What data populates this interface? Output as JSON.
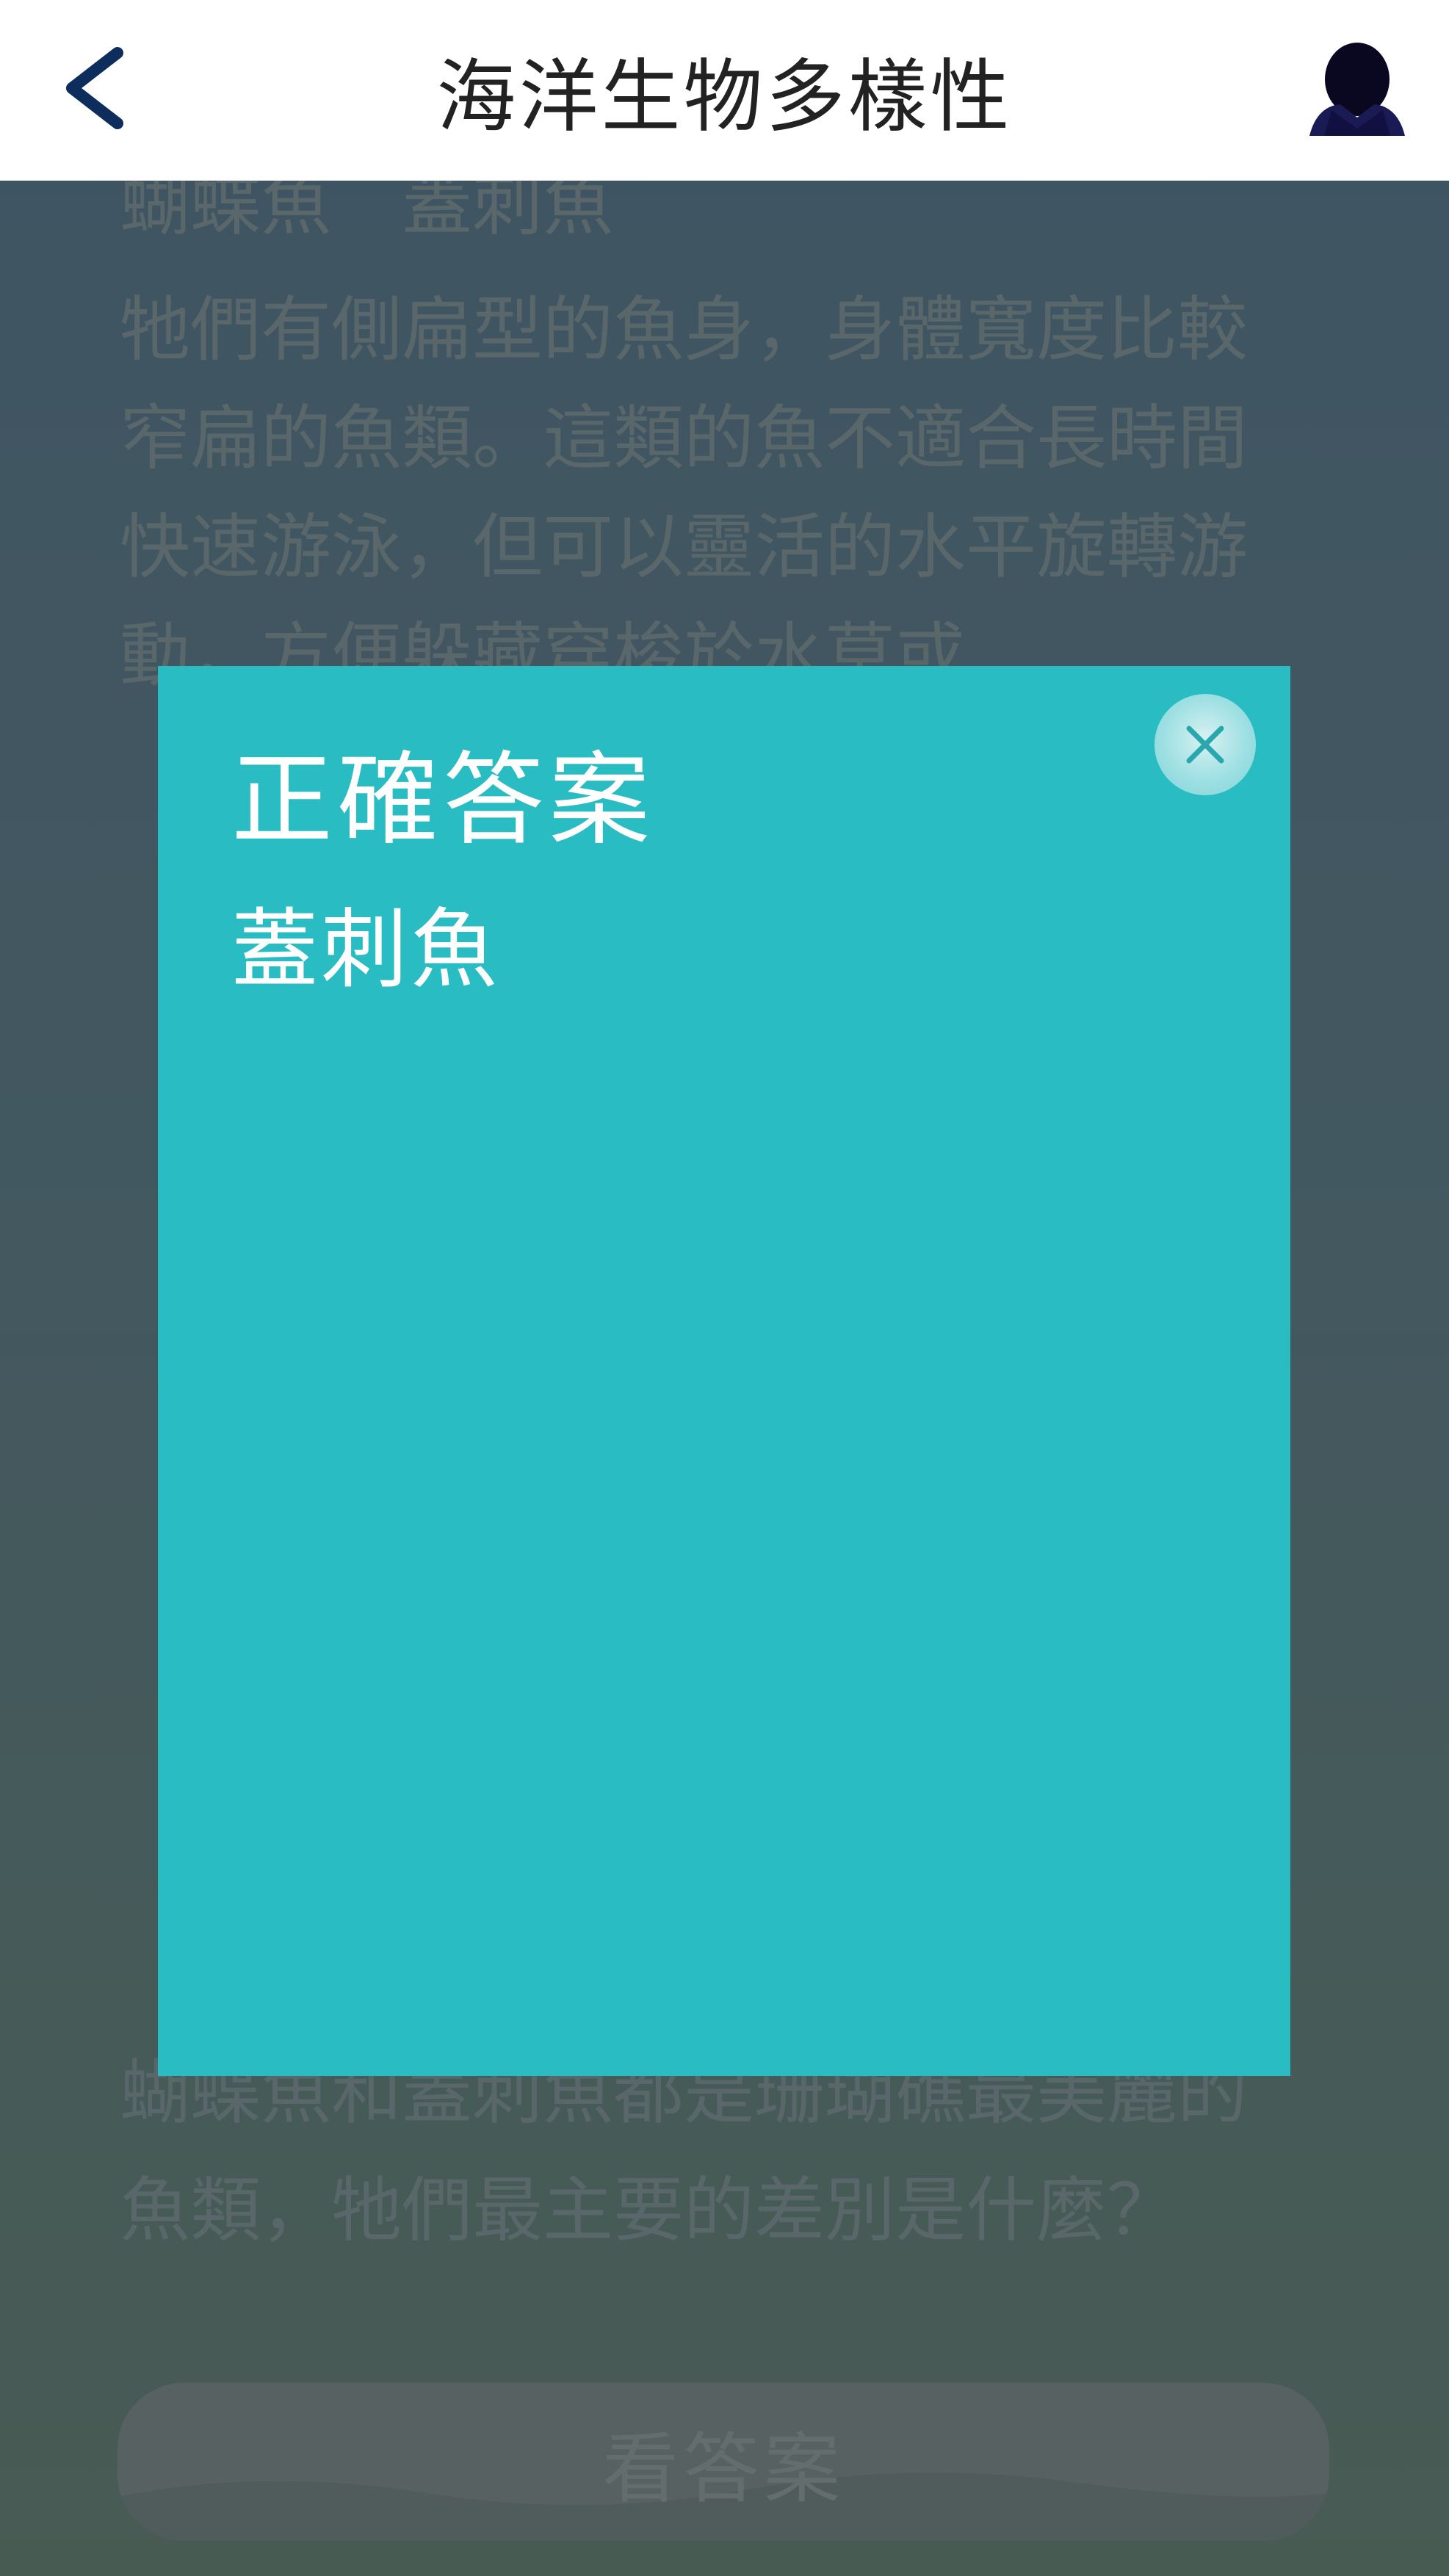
{
  "header": {
    "title": "海洋生物多樣性",
    "back_icon": "chevron-left-icon",
    "avatar_icon": "user-avatar-icon"
  },
  "content": {
    "prev_line": "蝴蝶魚　蓋刺魚",
    "description": "牠們有側扁型的魚身，身體寬度比較窄扁的魚類。這類的魚不適合長時間快速游泳，但可以靈活的水平旋轉游動，方便躲藏穿梭於水草或",
    "question": "蝴蝶魚和蓋刺魚都是珊瑚礁最美麗的魚類，牠們最主要的差別是什麼？",
    "answer_button_label": "看答案"
  },
  "modal": {
    "title": "正確答案",
    "answer": "蓋刺魚",
    "close_icon": "close-icon"
  },
  "colors": {
    "modal_bg": "#2abcc3",
    "header_bg": "#ffffff",
    "back_icon": "#0d2e5c",
    "avatar": "#0a0820"
  }
}
